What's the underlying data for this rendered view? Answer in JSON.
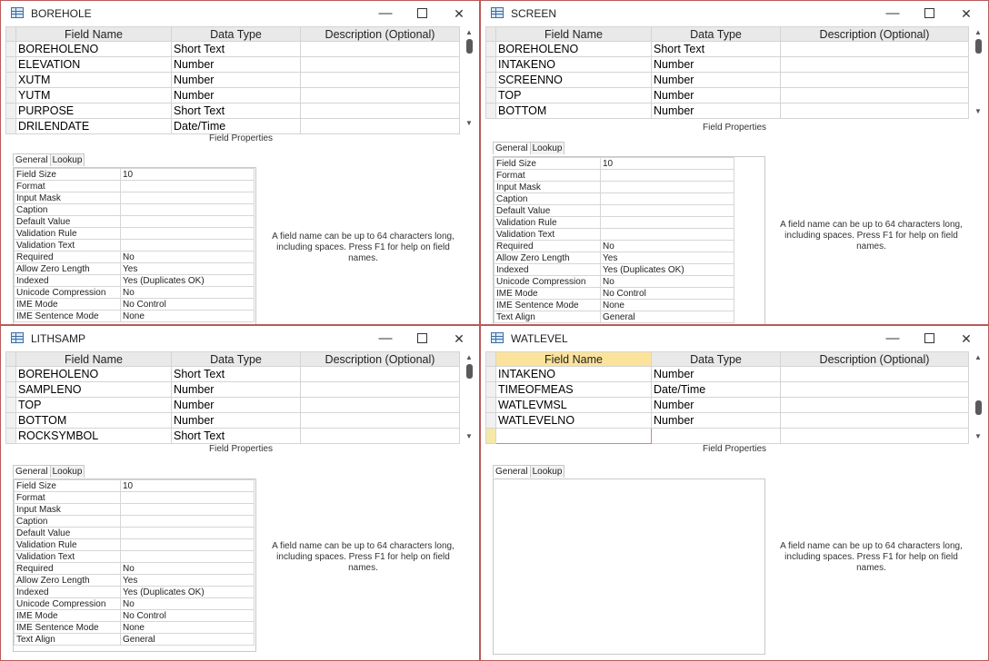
{
  "windows": {
    "borehole": {
      "title": "BOREHOLE",
      "columns": [
        "Field Name",
        "Data Type",
        "Description (Optional)"
      ],
      "rows": [
        {
          "name": "BOREHOLENO",
          "type": "Short Text"
        },
        {
          "name": "ELEVATION",
          "type": "Number"
        },
        {
          "name": "XUTM",
          "type": "Number"
        },
        {
          "name": "YUTM",
          "type": "Number"
        },
        {
          "name": "PURPOSE",
          "type": "Short Text"
        },
        {
          "name": "DRILENDATE",
          "type": "Date/Time"
        }
      ],
      "field_properties_label": "Field Properties",
      "tabs": {
        "general": "General",
        "lookup": "Lookup"
      },
      "props": [
        {
          "k": "Field Size",
          "v": "10"
        },
        {
          "k": "Format",
          "v": ""
        },
        {
          "k": "Input Mask",
          "v": ""
        },
        {
          "k": "Caption",
          "v": ""
        },
        {
          "k": "Default Value",
          "v": ""
        },
        {
          "k": "Validation Rule",
          "v": ""
        },
        {
          "k": "Validation Text",
          "v": ""
        },
        {
          "k": "Required",
          "v": "No"
        },
        {
          "k": "Allow Zero Length",
          "v": "Yes"
        },
        {
          "k": "Indexed",
          "v": "Yes (Duplicates OK)"
        },
        {
          "k": "Unicode Compression",
          "v": "No"
        },
        {
          "k": "IME Mode",
          "v": "No Control"
        },
        {
          "k": "IME Sentence Mode",
          "v": "None"
        }
      ],
      "help": "A field name can be up to 64 characters long, including spaces. Press F1 for help on field names."
    },
    "screen": {
      "title": "SCREEN",
      "columns": [
        "Field Name",
        "Data Type",
        "Description (Optional)"
      ],
      "rows": [
        {
          "name": "BOREHOLENO",
          "type": "Short Text"
        },
        {
          "name": "INTAKENO",
          "type": "Number"
        },
        {
          "name": "SCREENNO",
          "type": "Number"
        },
        {
          "name": "TOP",
          "type": "Number"
        },
        {
          "name": "BOTTOM",
          "type": "Number"
        }
      ],
      "field_properties_label": "Field Properties",
      "tabs": {
        "general": "General",
        "lookup": "Lookup"
      },
      "props": [
        {
          "k": "Field Size",
          "v": "10"
        },
        {
          "k": "Format",
          "v": ""
        },
        {
          "k": "Input Mask",
          "v": ""
        },
        {
          "k": "Caption",
          "v": ""
        },
        {
          "k": "Default Value",
          "v": ""
        },
        {
          "k": "Validation Rule",
          "v": ""
        },
        {
          "k": "Validation Text",
          "v": ""
        },
        {
          "k": "Required",
          "v": "No"
        },
        {
          "k": "Allow Zero Length",
          "v": "Yes"
        },
        {
          "k": "Indexed",
          "v": "Yes (Duplicates OK)"
        },
        {
          "k": "Unicode Compression",
          "v": "No"
        },
        {
          "k": "IME Mode",
          "v": "No Control"
        },
        {
          "k": "IME Sentence Mode",
          "v": "None"
        },
        {
          "k": "Text Align",
          "v": "General"
        }
      ],
      "help": "A field name can be up to 64 characters long, including spaces. Press F1 for help on field names."
    },
    "lithsamp": {
      "title": "LITHSAMP",
      "columns": [
        "Field Name",
        "Data Type",
        "Description (Optional)"
      ],
      "rows": [
        {
          "name": "BOREHOLENO",
          "type": "Short Text"
        },
        {
          "name": "SAMPLENO",
          "type": "Number"
        },
        {
          "name": "TOP",
          "type": "Number"
        },
        {
          "name": "BOTTOM",
          "type": "Number"
        },
        {
          "name": "ROCKSYMBOL",
          "type": "Short Text"
        }
      ],
      "field_properties_label": "Field Properties",
      "tabs": {
        "general": "General",
        "lookup": "Lookup"
      },
      "props": [
        {
          "k": "Field Size",
          "v": "10"
        },
        {
          "k": "Format",
          "v": ""
        },
        {
          "k": "Input Mask",
          "v": ""
        },
        {
          "k": "Caption",
          "v": ""
        },
        {
          "k": "Default Value",
          "v": ""
        },
        {
          "k": "Validation Rule",
          "v": ""
        },
        {
          "k": "Validation Text",
          "v": ""
        },
        {
          "k": "Required",
          "v": "No"
        },
        {
          "k": "Allow Zero Length",
          "v": "Yes"
        },
        {
          "k": "Indexed",
          "v": "Yes (Duplicates OK)"
        },
        {
          "k": "Unicode Compression",
          "v": "No"
        },
        {
          "k": "IME Mode",
          "v": "No Control"
        },
        {
          "k": "IME Sentence Mode",
          "v": "None"
        },
        {
          "k": "Text Align",
          "v": "General"
        }
      ],
      "help": "A field name can be up to 64 characters long, including spaces. Press F1 for help on field names."
    },
    "watlevel": {
      "title": "WATLEVEL",
      "columns": [
        "Field Name",
        "Data Type",
        "Description (Optional)"
      ],
      "rows": [
        {
          "name": "INTAKENO",
          "type": "Number"
        },
        {
          "name": "TIMEOFMEAS",
          "type": "Date/Time"
        },
        {
          "name": "WATLEVMSL",
          "type": "Number"
        },
        {
          "name": "WATLEVELNO",
          "type": "Number"
        },
        {
          "name": "",
          "type": ""
        }
      ],
      "field_properties_label": "Field Properties",
      "tabs": {
        "general": "General",
        "lookup": "Lookup"
      },
      "help": "A field name can be up to 64 characters long, including spaces. Press F1 for help on field names."
    }
  },
  "titlebar_buttons": {
    "minimize": "—",
    "close": "✕"
  },
  "colors": {
    "window_border": "#b85a5a",
    "active_header": "#fbe39b"
  }
}
